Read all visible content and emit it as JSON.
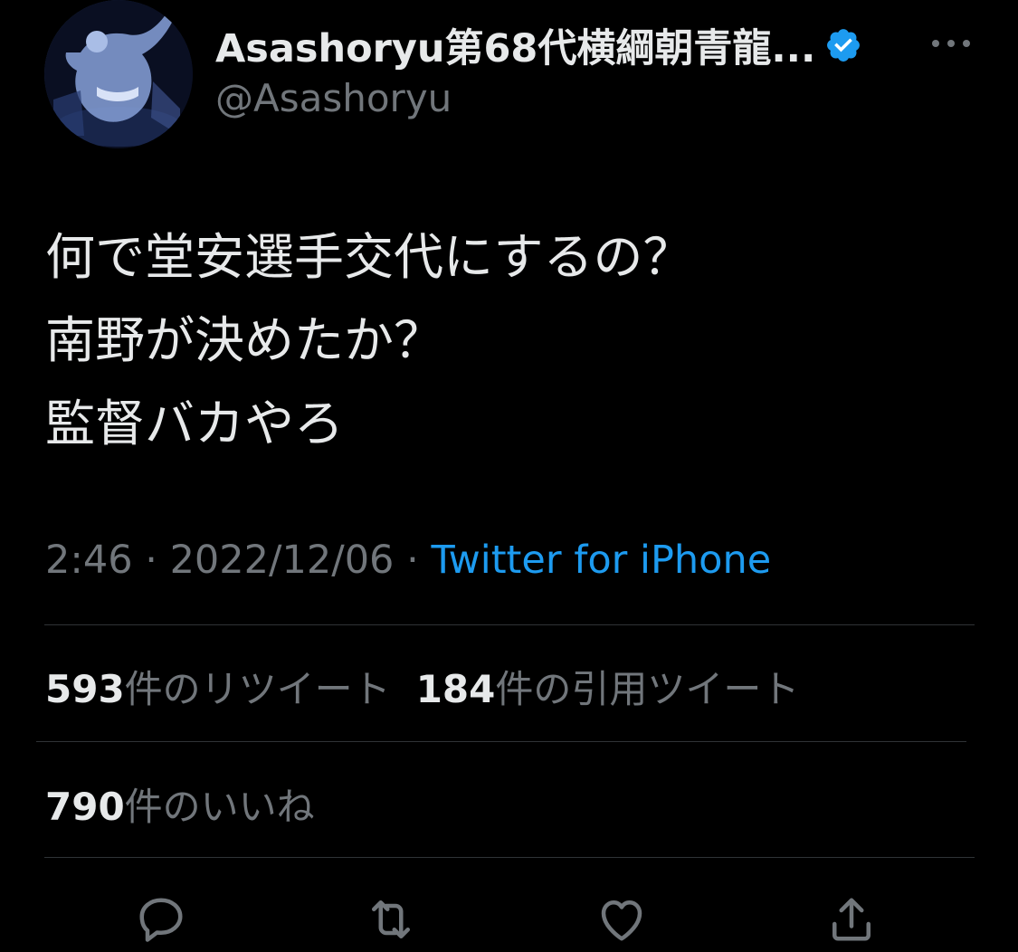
{
  "author": {
    "display_name": "Asashoryu第68代横綱朝青龍...",
    "handle": "@Asashoryu",
    "verified": true,
    "avatar_icon": "sumo-wrestler-photo"
  },
  "tweet": {
    "lines": [
      "何で堂安選手交代にするの？",
      "南野が決めたか？",
      "監督バカやろ"
    ],
    "time": "2:46",
    "separator": "·",
    "date": "2022/12/06",
    "source": "Twitter for iPhone"
  },
  "stats": {
    "retweets_count": "593",
    "retweets_label": "件のリツイート",
    "quotes_count": "184",
    "quotes_label": "件の引用ツイート",
    "likes_count": "790",
    "likes_label": "件のいいね"
  },
  "actions": {
    "reply_icon": "reply-icon",
    "retweet_icon": "retweet-icon",
    "like_icon": "heart-icon",
    "share_icon": "share-icon"
  },
  "colors": {
    "background": "#000000",
    "primary_text": "#e7e9ea",
    "secondary_text": "#71767b",
    "accent": "#1d9bf0",
    "divider": "#2f3336"
  }
}
